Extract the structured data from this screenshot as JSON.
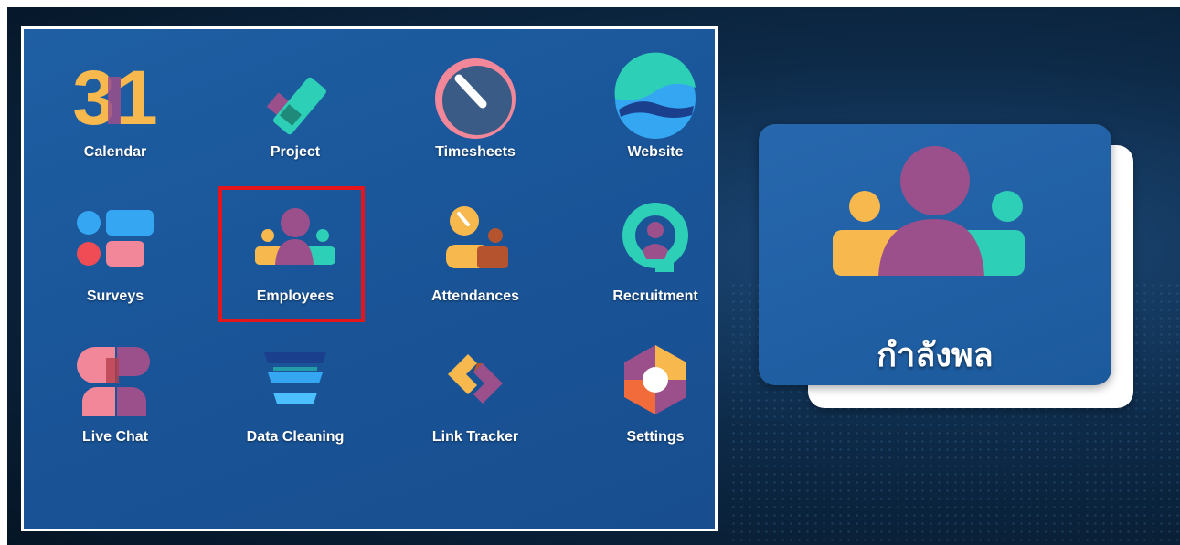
{
  "apps": [
    {
      "id": "calendar",
      "label": "Calendar",
      "icon": "calendar-icon",
      "number": "31"
    },
    {
      "id": "project",
      "label": "Project",
      "icon": "project-icon"
    },
    {
      "id": "timesheets",
      "label": "Timesheets",
      "icon": "timesheets-icon"
    },
    {
      "id": "website",
      "label": "Website",
      "icon": "website-icon"
    },
    {
      "id": "surveys",
      "label": "Surveys",
      "icon": "surveys-icon"
    },
    {
      "id": "employees",
      "label": "Employees",
      "icon": "employees-icon"
    },
    {
      "id": "attendances",
      "label": "Attendances",
      "icon": "attendances-icon"
    },
    {
      "id": "recruitment",
      "label": "Recruitment",
      "icon": "recruitment-icon"
    },
    {
      "id": "live_chat",
      "label": "Live Chat",
      "icon": "live-chat-icon"
    },
    {
      "id": "data_cleaning",
      "label": "Data Cleaning",
      "icon": "data-cleaning-icon"
    },
    {
      "id": "link_tracker",
      "label": "Link Tracker",
      "icon": "link-tracker-icon"
    },
    {
      "id": "settings",
      "label": "Settings",
      "icon": "settings-icon"
    }
  ],
  "highlighted_app": "employees",
  "card": {
    "label": "กำลังพล",
    "icon": "employees-icon"
  },
  "colors": {
    "highlight": "#e5161b",
    "yellow": "#f7b84e",
    "purple": "#9b4f8b",
    "teal": "#2dcfb6",
    "blue": "#35a7f2",
    "red": "#ef4c55",
    "pink": "#f2879a"
  }
}
